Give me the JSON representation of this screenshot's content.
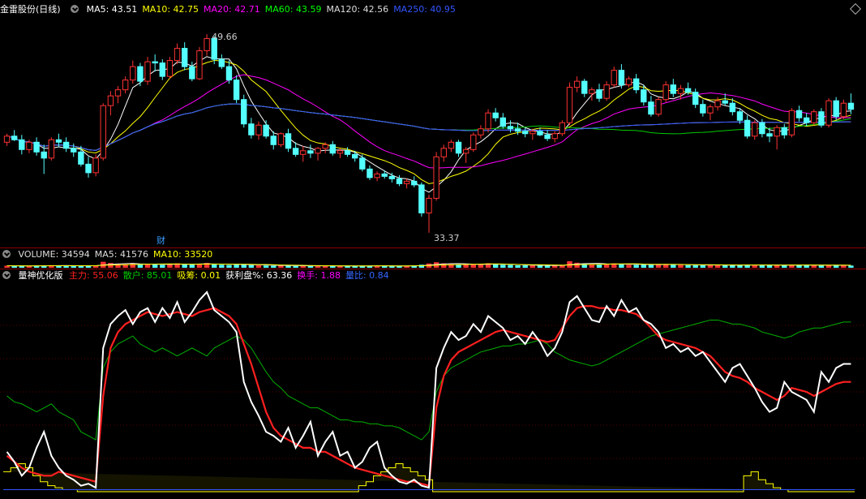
{
  "chart_data": {
    "type": "candlestick",
    "main": {
      "title": "金雷股份(日线)",
      "ma_labels": [
        {
          "text": "MA5: 43.51",
          "color": "#ffffff"
        },
        {
          "text": "MA10: 42.75",
          "color": "#ffff00"
        },
        {
          "text": "MA20: 42.71",
          "color": "#ff00ff"
        },
        {
          "text": "MA60: 43.59",
          "color": "#00ff00"
        },
        {
          "text": "MA120: 42.56",
          "color": "#dddddd"
        },
        {
          "text": "MA250: 40.95",
          "color": "#3355ff"
        }
      ],
      "high_label": "49.66",
      "low_label": "33.37",
      "event_marker": "财",
      "ylim": [
        32.5,
        51.0
      ],
      "candles": [
        [
          40.8,
          41.5,
          40.5,
          41.3
        ],
        [
          41.3,
          41.8,
          40.9,
          41.0
        ],
        [
          41.0,
          41.4,
          39.8,
          40.2
        ],
        [
          40.2,
          41.0,
          39.9,
          40.8
        ],
        [
          40.8,
          41.2,
          39.7,
          40.0
        ],
        [
          40.0,
          40.6,
          38.2,
          39.5
        ],
        [
          39.5,
          41.2,
          39.3,
          41.0
        ],
        [
          41.0,
          41.5,
          40.4,
          40.8
        ],
        [
          40.8,
          41.2,
          40.0,
          40.3
        ],
        [
          40.3,
          40.7,
          39.6,
          40.0
        ],
        [
          40.0,
          40.5,
          38.8,
          39.0
        ],
        [
          39.0,
          39.6,
          37.9,
          38.3
        ],
        [
          38.3,
          39.8,
          38.0,
          39.5
        ],
        [
          39.5,
          44.0,
          39.3,
          43.8
        ],
        [
          43.8,
          45.0,
          43.0,
          44.6
        ],
        [
          44.6,
          45.4,
          44.0,
          45.1
        ],
        [
          45.1,
          46.2,
          44.8,
          45.9
        ],
        [
          45.9,
          47.5,
          45.6,
          47.0
        ],
        [
          47.0,
          47.3,
          45.4,
          45.8
        ],
        [
          45.8,
          47.8,
          45.5,
          47.4
        ],
        [
          47.4,
          48.0,
          46.6,
          47.3
        ],
        [
          47.3,
          47.6,
          45.9,
          46.2
        ],
        [
          46.2,
          47.8,
          46.0,
          47.5
        ],
        [
          47.5,
          48.9,
          47.2,
          48.5
        ],
        [
          48.5,
          49.0,
          46.7,
          47.0
        ],
        [
          47.0,
          47.4,
          45.8,
          46.0
        ],
        [
          46.0,
          48.6,
          45.9,
          48.3
        ],
        [
          48.3,
          49.66,
          47.9,
          49.3
        ],
        [
          49.3,
          49.5,
          47.2,
          47.6
        ],
        [
          47.6,
          48.0,
          46.8,
          47.0
        ],
        [
          47.0,
          47.5,
          45.6,
          45.9
        ],
        [
          45.9,
          46.3,
          44.0,
          44.3
        ],
        [
          44.3,
          44.7,
          42.0,
          42.3
        ],
        [
          42.3,
          42.8,
          41.1,
          41.4
        ],
        [
          41.4,
          42.5,
          41.0,
          42.2
        ],
        [
          42.2,
          42.6,
          41.1,
          41.3
        ],
        [
          41.3,
          41.7,
          40.2,
          40.6
        ],
        [
          40.6,
          41.6,
          40.4,
          41.5
        ],
        [
          41.5,
          41.9,
          40.0,
          40.3
        ],
        [
          40.3,
          40.8,
          39.6,
          39.8
        ],
        [
          39.8,
          40.5,
          39.2,
          40.1
        ],
        [
          40.1,
          40.6,
          39.5,
          39.9
        ],
        [
          39.9,
          40.4,
          39.3,
          40.3
        ],
        [
          40.3,
          40.8,
          39.9,
          40.6
        ],
        [
          40.6,
          40.9,
          39.7,
          39.9
        ],
        [
          39.9,
          40.3,
          39.5,
          40.1
        ],
        [
          40.1,
          40.4,
          39.6,
          39.8
        ],
        [
          39.8,
          40.1,
          39.2,
          39.5
        ],
        [
          39.5,
          39.8,
          38.4,
          38.6
        ],
        [
          38.6,
          38.9,
          37.7,
          37.9
        ],
        [
          37.9,
          38.4,
          37.6,
          38.2
        ],
        [
          38.2,
          38.5,
          37.8,
          38.0
        ],
        [
          38.0,
          38.3,
          37.5,
          37.8
        ],
        [
          37.8,
          38.1,
          37.2,
          37.4
        ],
        [
          37.4,
          37.8,
          37.0,
          37.6
        ],
        [
          37.6,
          38.0,
          37.1,
          37.3
        ],
        [
          37.3,
          37.5,
          34.7,
          35.0
        ],
        [
          35.0,
          36.5,
          33.37,
          36.2
        ],
        [
          36.2,
          40.0,
          36.0,
          39.6
        ],
        [
          39.6,
          40.6,
          39.2,
          40.3
        ],
        [
          40.3,
          41.0,
          40.0,
          40.8
        ],
        [
          40.8,
          41.0,
          39.6,
          39.9
        ],
        [
          39.9,
          40.4,
          39.1,
          40.2
        ],
        [
          40.2,
          41.6,
          40.0,
          41.4
        ],
        [
          41.4,
          42.2,
          41.1,
          41.9
        ],
        [
          41.9,
          43.5,
          41.6,
          43.2
        ],
        [
          43.2,
          43.6,
          42.5,
          42.8
        ],
        [
          42.8,
          43.2,
          41.9,
          42.1
        ],
        [
          42.1,
          42.6,
          41.6,
          41.9
        ],
        [
          41.9,
          42.4,
          41.4,
          41.7
        ],
        [
          41.7,
          42.0,
          41.2,
          41.5
        ],
        [
          41.5,
          41.9,
          41.0,
          41.7
        ],
        [
          41.7,
          42.0,
          41.3,
          41.4
        ],
        [
          41.4,
          41.8,
          40.9,
          41.1
        ],
        [
          41.1,
          41.7,
          40.8,
          41.5
        ],
        [
          41.5,
          42.6,
          41.3,
          42.4
        ],
        [
          42.4,
          45.7,
          42.2,
          45.3
        ],
        [
          45.3,
          46.2,
          44.9,
          45.8
        ],
        [
          45.8,
          46.0,
          44.5,
          44.8
        ],
        [
          44.8,
          45.3,
          44.2,
          45.1
        ],
        [
          45.1,
          45.6,
          44.1,
          44.4
        ],
        [
          44.4,
          45.8,
          44.2,
          45.5
        ],
        [
          45.5,
          47.0,
          45.3,
          46.7
        ],
        [
          46.7,
          47.2,
          45.2,
          45.5
        ],
        [
          45.5,
          46.2,
          45.3,
          46.0
        ],
        [
          46.0,
          46.4,
          44.8,
          45.1
        ],
        [
          45.1,
          45.5,
          43.8,
          44.1
        ],
        [
          44.1,
          44.6,
          42.9,
          43.1
        ],
        [
          43.1,
          44.5,
          42.9,
          44.3
        ],
        [
          44.3,
          45.8,
          44.1,
          45.5
        ],
        [
          45.5,
          46.0,
          44.5,
          44.8
        ],
        [
          44.8,
          45.5,
          44.3,
          45.2
        ],
        [
          45.2,
          45.7,
          44.7,
          44.9
        ],
        [
          44.9,
          45.2,
          43.6,
          43.9
        ],
        [
          43.9,
          44.3,
          42.9,
          43.2
        ],
        [
          43.2,
          43.9,
          42.6,
          43.7
        ],
        [
          43.7,
          44.5,
          43.4,
          44.2
        ],
        [
          44.2,
          44.8,
          43.8,
          44.0
        ],
        [
          44.0,
          44.4,
          43.0,
          43.3
        ],
        [
          43.3,
          43.6,
          42.3,
          42.6
        ],
        [
          42.6,
          43.0,
          41.1,
          41.3
        ],
        [
          41.3,
          42.6,
          41.0,
          42.4
        ],
        [
          42.4,
          42.7,
          41.2,
          41.5
        ],
        [
          41.5,
          42.0,
          40.8,
          41.3
        ],
        [
          41.3,
          42.2,
          40.2,
          42.0
        ],
        [
          42.0,
          42.3,
          41.1,
          41.4
        ],
        [
          41.4,
          43.6,
          41.2,
          43.4
        ],
        [
          43.4,
          43.8,
          42.5,
          42.8
        ],
        [
          42.8,
          43.2,
          42.1,
          42.4
        ],
        [
          42.4,
          43.5,
          42.2,
          43.3
        ],
        [
          43.3,
          43.6,
          42.0,
          42.2
        ],
        [
          42.2,
          44.4,
          42.0,
          44.2
        ],
        [
          44.2,
          44.5,
          42.6,
          42.9
        ],
        [
          42.9,
          44.3,
          42.7,
          44.0
        ],
        [
          44.0,
          44.8,
          43.1,
          43.5
        ]
      ]
    },
    "volume": {
      "labels": [
        {
          "text": "VOLUME: 34594",
          "color": "#dddddd"
        },
        {
          "text": "MA5: 41576",
          "color": "#dddddd"
        },
        {
          "text": "MA10: 33520",
          "color": "#ffff00"
        }
      ],
      "values": [
        41,
        38,
        36,
        33,
        40,
        45,
        52,
        44,
        38,
        35,
        39,
        42,
        48,
        120,
        95,
        80,
        70,
        85,
        60,
        75,
        66,
        58,
        72,
        88,
        70,
        62,
        80,
        96,
        72,
        60,
        55,
        63,
        70,
        54,
        48,
        45,
        40,
        44,
        42,
        38,
        36,
        35,
        39,
        41,
        37,
        35,
        33,
        36,
        40,
        42,
        38,
        35,
        34,
        37,
        39,
        44,
        60,
        85,
        110,
        90,
        75,
        62,
        58,
        66,
        72,
        90,
        70,
        60,
        55,
        50,
        48,
        46,
        44,
        43,
        47,
        55,
        130,
        100,
        80,
        70,
        65,
        72,
        88,
        70,
        60,
        58,
        62,
        70,
        66,
        74,
        60,
        55,
        52,
        56,
        60,
        54,
        50,
        48,
        52,
        58,
        64,
        56,
        50,
        48,
        55,
        50,
        62,
        54,
        48,
        52,
        46,
        58,
        50,
        47,
        44
      ]
    },
    "indicator": {
      "title": "量神优化版",
      "labels": [
        {
          "text": "主力: 55.06",
          "color": "#ff2020"
        },
        {
          "text": "散户: 85.01",
          "color": "#00cc00"
        },
        {
          "text": "吸筹: 0.01",
          "color": "#ffff00"
        },
        {
          "text": "获利盘%: 63.36",
          "color": "#ffffff"
        },
        {
          "text": "换手: 1.88",
          "color": "#ff00ff"
        },
        {
          "text": "量比: 0.84",
          "color": "#3366ff"
        }
      ],
      "ylim": [
        0,
        100
      ],
      "profit": [
        20,
        15,
        8,
        12,
        22,
        30,
        18,
        12,
        8,
        6,
        3,
        4,
        2,
        72,
        84,
        88,
        91,
        84,
        90,
        92,
        85,
        92,
        87,
        95,
        85,
        90,
        96,
        100,
        91,
        88,
        85,
        80,
        55,
        45,
        38,
        30,
        28,
        25,
        32,
        22,
        28,
        35,
        18,
        25,
        30,
        18,
        20,
        12,
        15,
        22,
        25,
        12,
        8,
        5,
        4,
        6,
        3,
        2,
        62,
        72,
        80,
        76,
        78,
        84,
        80,
        88,
        85,
        82,
        76,
        78,
        74,
        80,
        75,
        68,
        72,
        80,
        95,
        98,
        92,
        86,
        85,
        93,
        88,
        96,
        90,
        92,
        86,
        84,
        80,
        72,
        74,
        70,
        72,
        68,
        70,
        65,
        60,
        55,
        62,
        64,
        58,
        52,
        45,
        40,
        42,
        55,
        50,
        48,
        46,
        40,
        60,
        55,
        62,
        64,
        64
      ],
      "main_force": [
        18,
        15,
        12,
        10,
        9,
        8,
        8,
        10,
        9,
        8,
        7,
        6,
        5,
        48,
        72,
        80,
        84,
        86,
        88,
        90,
        89,
        88,
        89,
        90,
        89,
        88,
        90,
        91,
        92,
        90,
        88,
        84,
        74,
        64,
        52,
        40,
        32,
        28,
        26,
        24,
        22,
        22,
        20,
        20,
        18,
        16,
        14,
        12,
        11,
        10,
        9,
        8,
        7,
        6,
        5,
        5,
        4,
        3,
        42,
        58,
        66,
        70,
        72,
        74,
        76,
        78,
        80,
        81,
        80,
        79,
        78,
        77,
        76,
        75,
        76,
        82,
        88,
        92,
        93,
        93,
        92,
        92,
        91,
        91,
        90,
        89,
        86,
        82,
        78,
        76,
        75,
        74,
        73,
        72,
        70,
        68,
        64,
        60,
        58,
        57,
        55,
        52,
        50,
        48,
        46,
        48,
        52,
        51,
        50,
        48,
        50,
        52,
        54,
        55,
        55
      ],
      "retail": [
        48,
        45,
        44,
        42,
        40,
        42,
        44,
        40,
        38,
        36,
        30,
        28,
        26,
        62,
        70,
        74,
        76,
        78,
        74,
        72,
        70,
        72,
        70,
        68,
        70,
        72,
        70,
        68,
        72,
        74,
        76,
        78,
        76,
        72,
        66,
        60,
        55,
        52,
        48,
        46,
        44,
        42,
        42,
        40,
        38,
        36,
        36,
        35,
        35,
        34,
        34,
        33,
        33,
        32,
        30,
        28,
        26,
        30,
        50,
        58,
        62,
        64,
        66,
        68,
        70,
        71,
        72,
        73,
        73,
        74,
        74,
        75,
        76,
        74,
        70,
        68,
        66,
        65,
        64,
        63,
        64,
        66,
        68,
        70,
        72,
        74,
        76,
        78,
        79,
        80,
        81,
        82,
        83,
        84,
        85,
        86,
        86,
        85,
        84,
        84,
        83,
        82,
        80,
        79,
        78,
        77,
        78,
        80,
        81,
        82,
        82,
        83,
        84,
        85,
        85
      ],
      "accum": [
        10,
        12,
        14,
        12,
        8,
        5,
        3,
        2,
        1,
        1,
        0,
        0,
        0,
        0,
        0,
        0,
        0,
        0,
        0,
        0,
        0,
        0,
        0,
        0,
        0,
        0,
        0,
        0,
        0,
        0,
        0,
        0,
        0,
        0,
        0,
        0,
        0,
        0,
        0,
        0,
        0,
        0,
        0,
        0,
        0,
        0,
        0,
        0,
        3,
        5,
        8,
        10,
        12,
        14,
        12,
        10,
        8,
        6,
        0,
        0,
        0,
        0,
        0,
        0,
        0,
        0,
        0,
        0,
        0,
        0,
        0,
        0,
        0,
        0,
        0,
        0,
        0,
        0,
        0,
        0,
        0,
        0,
        0,
        0,
        0,
        0,
        0,
        0,
        0,
        0,
        0,
        0,
        0,
        0,
        0,
        0,
        0,
        0,
        0,
        0,
        8,
        10,
        6,
        4,
        2,
        1,
        0,
        0,
        0,
        0,
        0,
        0,
        0,
        0,
        0
      ]
    }
  }
}
